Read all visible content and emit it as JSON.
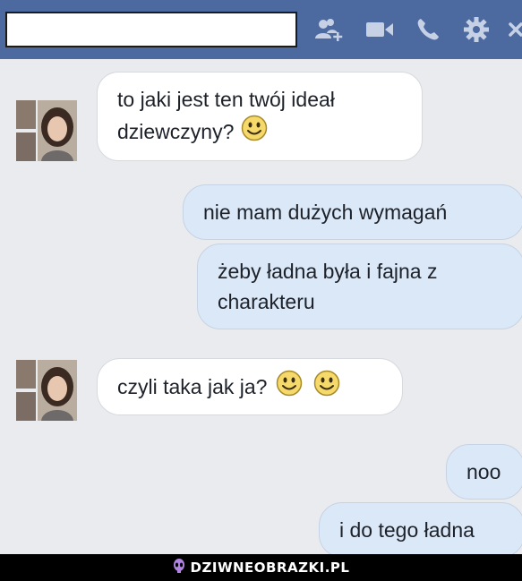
{
  "header": {
    "icons": [
      "add-person-icon",
      "video-call-icon",
      "phone-icon",
      "gear-icon",
      "close-icon"
    ],
    "colors": {
      "bar": "#4c6aa0",
      "icon": "#c6d1e6"
    }
  },
  "messages": [
    {
      "side": "in",
      "line1": "to jaki jest ten twój ideał",
      "line2": "dziewczyny?",
      "emoji": "smiley-emoji"
    },
    {
      "side": "out",
      "text": "nie mam dużych wymagań"
    },
    {
      "side": "out",
      "line1": "żeby ładna była i fajna z",
      "line2": "charakteru"
    },
    {
      "side": "in",
      "text": "czyli taka jak ja?",
      "emoji": "smiley-emoji"
    },
    {
      "side": "out",
      "text": "noo"
    },
    {
      "side": "out",
      "text": "i do tego ładna"
    }
  ],
  "watermark": {
    "text": "DZIWNEOBRAZKI.PL",
    "icon": "alien-icon"
  }
}
